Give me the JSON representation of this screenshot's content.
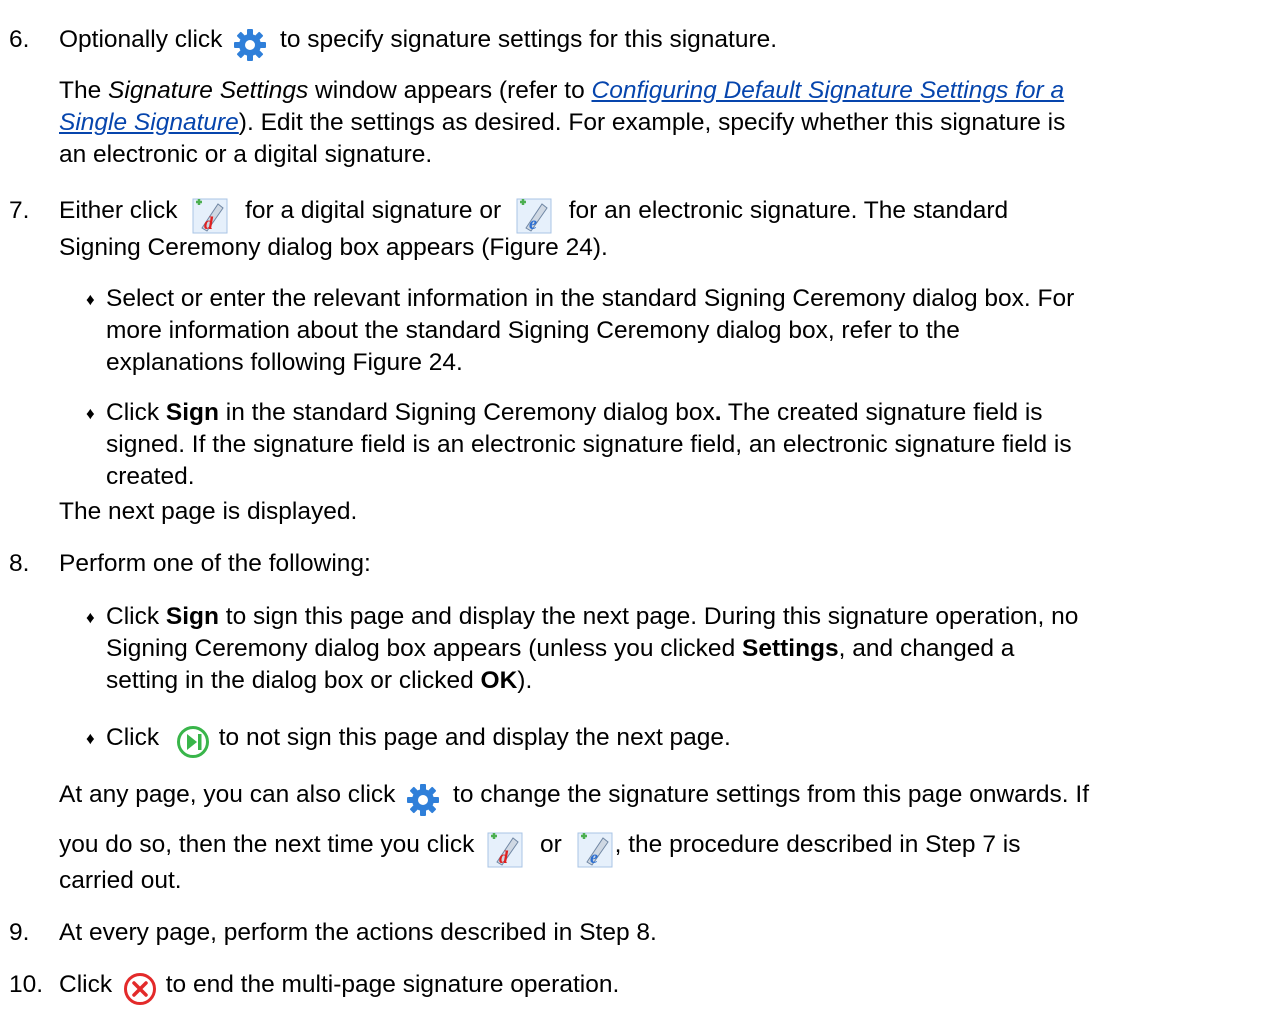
{
  "colors": {
    "gear": "#2f7fd9",
    "link": "#0645ad",
    "play_green": "#39b54a",
    "close_red": "#e32a2a",
    "sig_d_red": "#e02020",
    "sig_e_blue": "#2d6fd1",
    "sig_plus_green": "#4caf50"
  },
  "icons": {
    "settings": "gear-icon",
    "digital_sign": "digital-signature-icon",
    "electronic_sign": "electronic-signature-icon",
    "skip": "skip-next-icon",
    "close": "close-circle-icon"
  },
  "step6": {
    "num": "6.",
    "l1a": "Optionally click",
    "l1b": "to specify signature settings for this signature.",
    "p_a": "The ",
    "p_em": "Signature Settings",
    "p_b": " window appears (refer to ",
    "link1": "Configuring Default Signature Settings for a",
    "link2": "Single Signature",
    "p_c": "). Edit the settings as desired. For example, specify whether this signature is",
    "p_d": "an electronic or a digital signature."
  },
  "step7": {
    "num": "7.",
    "l1a": "Either click",
    "l1b": "for a digital signature or",
    "l1c": "for an electronic signature. The standard",
    "l2": "Signing Ceremony dialog box appears (Figure 24).",
    "b1_l1": "Select or enter the relevant information in the standard Signing Ceremony dialog box. For",
    "b1_l2": "more information about the standard Signing Ceremony dialog box, refer to the",
    "b1_l3": "explanations following Figure 24.",
    "b2_a": "Click ",
    "b2_bold": "Sign",
    "b2_b": " in the standard Signing Ceremony dialog box",
    "b2_dot": ".",
    "b2_c": " The created signature field is",
    "b2_l2": "signed. If the signature field is an electronic signature field, an electronic signature field is",
    "b2_l3": "created.",
    "after": "The next page is displayed."
  },
  "step8": {
    "num": "8.",
    "l1": "Perform one of the following:",
    "b1_a": "Click ",
    "b1_bold": "Sign",
    "b1_b": " to sign this page and display the next page. During this signature operation, no",
    "b1_l2a": "Signing Ceremony dialog box appears (unless you clicked ",
    "b1_l2bold": "Settings",
    "b1_l2b": ", and changed a",
    "b1_l3a": "setting in the dialog box or clicked ",
    "b1_l3bold": "OK",
    "b1_l3b": ").",
    "b2_a": "Click",
    "b2_b": "to not sign this page and display the next page.",
    "p1a": "At any page, you can also click",
    "p1b": "to change the signature settings from this page onwards. If",
    "p2a": "you do so, then the next time you click",
    "p2b": "or",
    "p2c": ", the procedure described in Step 7 is",
    "p3": "carried out."
  },
  "step9": {
    "num": "9.",
    "text": "At every page, perform the actions described in Step 8."
  },
  "step10": {
    "num": "10.",
    "a": "Click",
    "b": "to end the multi-page signature operation."
  }
}
